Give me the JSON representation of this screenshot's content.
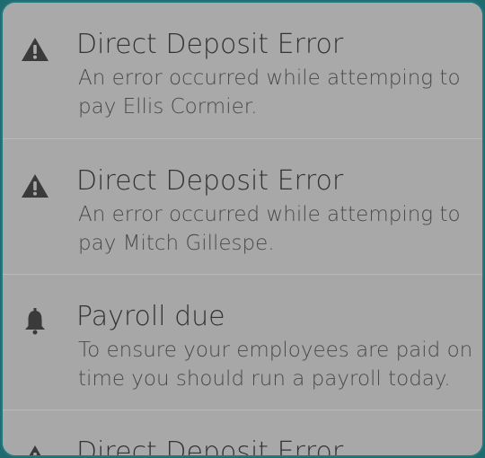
{
  "notifications": [
    {
      "icon": "warning-icon",
      "title": "Direct Deposit Error",
      "message": "An error occurred while attemping to pay Ellis Cormier."
    },
    {
      "icon": "warning-icon",
      "title": "Direct Deposit Error",
      "message": "An error occurred while attemping to pay Mitch Gillespe."
    },
    {
      "icon": "bell-icon",
      "title": "Payroll due",
      "message": "To ensure your employees are paid on time you should run a payroll today."
    },
    {
      "icon": "warning-icon",
      "title": "Direct Deposit Error",
      "message": ""
    }
  ],
  "colors": {
    "frame_border": "#1e7a80",
    "item_background": "#ababab",
    "title_text": "#333333",
    "body_text": "#4a4a4a",
    "icon": "#3a3a3a"
  }
}
